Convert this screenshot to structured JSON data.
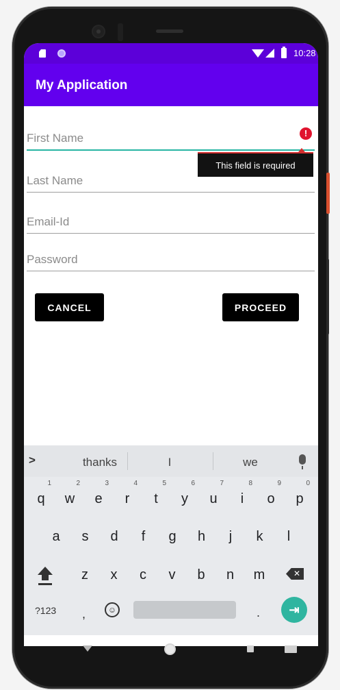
{
  "status_bar": {
    "time": "10:28"
  },
  "app_bar": {
    "title": "My Application"
  },
  "form": {
    "first_name": {
      "placeholder": "First Name",
      "value": ""
    },
    "last_name": {
      "placeholder": "Last Name",
      "value": ""
    },
    "email": {
      "placeholder": "Email-Id",
      "value": ""
    },
    "password": {
      "placeholder": "Password",
      "value": ""
    },
    "error_tooltip": "This field is required",
    "error_icon_glyph": "!",
    "cancel_label": "CANCEL",
    "proceed_label": "PROCEED"
  },
  "keyboard": {
    "expand_glyph": ">",
    "suggestions": [
      "thanks",
      "I",
      "we"
    ],
    "row1": [
      "q",
      "w",
      "e",
      "r",
      "t",
      "y",
      "u",
      "i",
      "o",
      "p"
    ],
    "row1_hints": [
      "1",
      "2",
      "3",
      "4",
      "5",
      "6",
      "7",
      "8",
      "9",
      "0"
    ],
    "row2": [
      "a",
      "s",
      "d",
      "f",
      "g",
      "h",
      "j",
      "k",
      "l"
    ],
    "row3": [
      "z",
      "x",
      "c",
      "v",
      "b",
      "n",
      "m"
    ],
    "symbols_label": "?123",
    "comma_label": ",",
    "period_label": ".",
    "emoji_glyph": "☺",
    "enter_glyph": "⇥",
    "backspace_glyph": "✕"
  },
  "icons": {
    "status": [
      "sd-card-icon",
      "notification-dot-icon",
      "wifi-icon",
      "signal-icon",
      "battery-icon"
    ],
    "navigation": [
      "back-icon",
      "home-icon",
      "recents-icon",
      "keyboard-switch-icon"
    ]
  },
  "colors": {
    "status_bar": "#5c00d9",
    "app_bar": "#6200ee",
    "focus_underline": "#26b5a3",
    "error": "#e0142e",
    "enter_key": "#2fb5a0"
  }
}
